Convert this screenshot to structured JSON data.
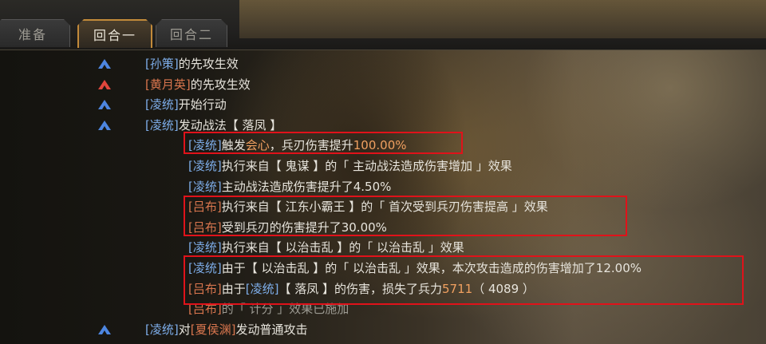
{
  "tabs": [
    "准备",
    "回合一",
    "回合二"
  ],
  "active_tab": 1,
  "log": [
    {
      "icon": "blue",
      "indent": 1,
      "parts": [
        [
          "blue",
          "[孙策]"
        ],
        [
          "w",
          "的先攻生效"
        ]
      ]
    },
    {
      "icon": "red",
      "indent": 1,
      "parts": [
        [
          "red",
          "[黄月英]"
        ],
        [
          "w",
          "的先攻生效"
        ]
      ]
    },
    {
      "icon": "blue",
      "indent": 1,
      "parts": [
        [
          "blue",
          "[凌统]"
        ],
        [
          "w",
          "开始行动"
        ]
      ]
    },
    {
      "icon": "blue",
      "indent": 1,
      "parts": [
        [
          "blue",
          "[凌统]"
        ],
        [
          "w",
          "发动战法【 落凤 】"
        ]
      ]
    },
    {
      "icon": "",
      "indent": 2,
      "parts": [
        [
          "blue",
          "[凌统]"
        ],
        [
          "w",
          "触发"
        ],
        [
          "orange",
          "会心"
        ],
        [
          "w",
          "，兵刃伤害提升"
        ],
        [
          "orange",
          "100.00%"
        ]
      ]
    },
    {
      "icon": "",
      "indent": 2,
      "parts": [
        [
          "blue",
          "[凌统]"
        ],
        [
          "w",
          "执行来自【 鬼谋 】的「 主动战法造成伤害增加 」效果"
        ]
      ]
    },
    {
      "icon": "",
      "indent": 2,
      "parts": [
        [
          "blue",
          "[凌统]"
        ],
        [
          "w",
          "主动战法造成伤害提升了4.50%"
        ]
      ]
    },
    {
      "icon": "",
      "indent": 2,
      "parts": [
        [
          "red",
          "[吕布]"
        ],
        [
          "w",
          "执行来自【 江东小霸王 】的「 首次受到兵刃伤害提高 」效果"
        ]
      ]
    },
    {
      "icon": "",
      "indent": 2,
      "parts": [
        [
          "red",
          "[吕布]"
        ],
        [
          "w",
          "受到兵刃的伤害提升了30.00%"
        ]
      ]
    },
    {
      "icon": "",
      "indent": 2,
      "parts": [
        [
          "blue",
          "[凌统]"
        ],
        [
          "w",
          "执行来自【 以治击乱 】的「 以治击乱 」效果"
        ]
      ]
    },
    {
      "icon": "",
      "indent": 2,
      "parts": [
        [
          "blue",
          "[凌统]"
        ],
        [
          "w",
          "由于【 以治击乱 】的「 以治击乱 」效果，本次攻击造成的伤害增加了12.00%"
        ]
      ]
    },
    {
      "icon": "",
      "indent": 2,
      "parts": [
        [
          "red",
          "[吕布]"
        ],
        [
          "w",
          "由于"
        ],
        [
          "blue",
          "[凌统]"
        ],
        [
          "w",
          "【 落凤 】的伤害，损失了兵力"
        ],
        [
          "orange",
          "5711"
        ],
        [
          "w",
          "（ 4089 ）"
        ]
      ]
    },
    {
      "icon": "",
      "indent": 2,
      "parts": [
        [
          "red",
          "[吕布]"
        ],
        [
          "gray",
          "的「 计分 」效果已施加"
        ]
      ]
    },
    {
      "icon": "blue",
      "indent": 1,
      "parts": [
        [
          "blue",
          "[凌统]"
        ],
        [
          "w",
          "对"
        ],
        [
          "red",
          "[夏侯渊]"
        ],
        [
          "w",
          "发动普通攻击"
        ]
      ]
    }
  ]
}
